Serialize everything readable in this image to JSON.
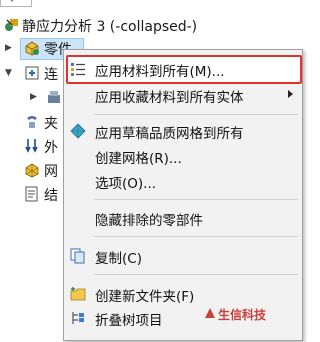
{
  "tree": {
    "study_title": "静应力分析 3 (-collapsed-)",
    "rows": [
      {
        "label": "零件",
        "icon": "parts-icon"
      },
      {
        "label": "连",
        "icon": "connections-icon"
      },
      {
        "label": "",
        "icon": "component-icon"
      },
      {
        "label": "夹",
        "icon": "fixtures-icon"
      },
      {
        "label": "外",
        "icon": "external-loads-icon"
      },
      {
        "label": "网",
        "icon": "mesh-icon"
      },
      {
        "label": "结",
        "icon": "results-icon"
      }
    ]
  },
  "context_menu": {
    "items": [
      {
        "label": "应用材料到所有(M)...",
        "icon": "apply-material-icon",
        "highlighted": true
      },
      {
        "label": "应用收藏材料到所有实体",
        "icon": "",
        "submenu": true
      },
      {
        "label": "应用草稿品质网格到所有",
        "icon": "draft-mesh-icon"
      },
      {
        "label": "创建网格(R)...",
        "icon": ""
      },
      {
        "label": "选项(O)...",
        "icon": ""
      },
      {
        "label": "隐藏排除的零部件",
        "icon": ""
      },
      {
        "label": "复制(C)",
        "icon": "copy-icon"
      },
      {
        "label": "创建新文件夹(F)",
        "icon": "new-folder-icon"
      },
      {
        "label": "折叠树项目",
        "icon": "collapse-tree-icon"
      }
    ]
  },
  "watermark": {
    "text": "生信科技"
  },
  "colors": {
    "highlight_border": "#e0332c",
    "menu_bg": "#f2f2f2"
  }
}
